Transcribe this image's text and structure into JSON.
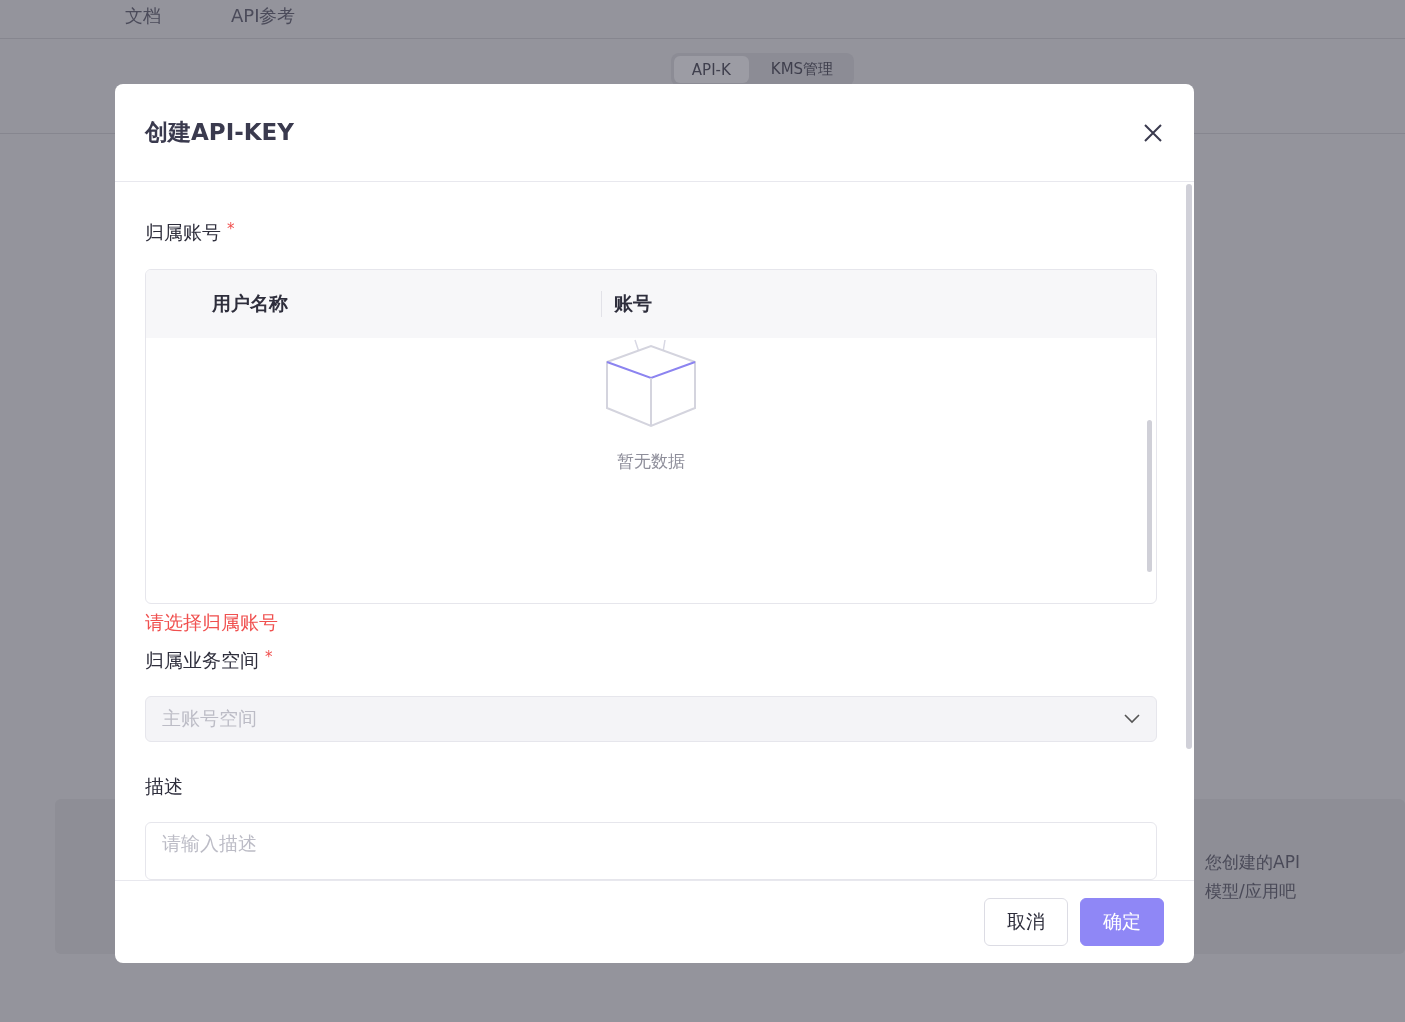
{
  "top_nav": [
    {
      "label": "文档"
    },
    {
      "label": "API参考"
    }
  ],
  "tabs": [
    {
      "label": "API-K",
      "selected": true
    },
    {
      "label": "KMS管理",
      "selected": false
    }
  ],
  "background_card": {
    "lines": [
      "您创建的API",
      "模型/应用吧"
    ]
  },
  "dialog": {
    "title": "创建API-KEY",
    "account_field": {
      "label": "归属账号",
      "required_mark": "*",
      "table": {
        "columns": [
          "用户名称",
          "账号"
        ],
        "empty_text": "暂无数据"
      },
      "error": "请选择归属账号"
    },
    "space_field": {
      "label": "归属业务空间",
      "required_mark": "*",
      "placeholder": "主账号空间",
      "disabled": true
    },
    "description_field": {
      "label": "描述",
      "placeholder": "请输入描述"
    },
    "buttons": [
      {
        "label": "取消",
        "kind": "default"
      },
      {
        "label": "确定",
        "kind": "primary"
      }
    ]
  }
}
